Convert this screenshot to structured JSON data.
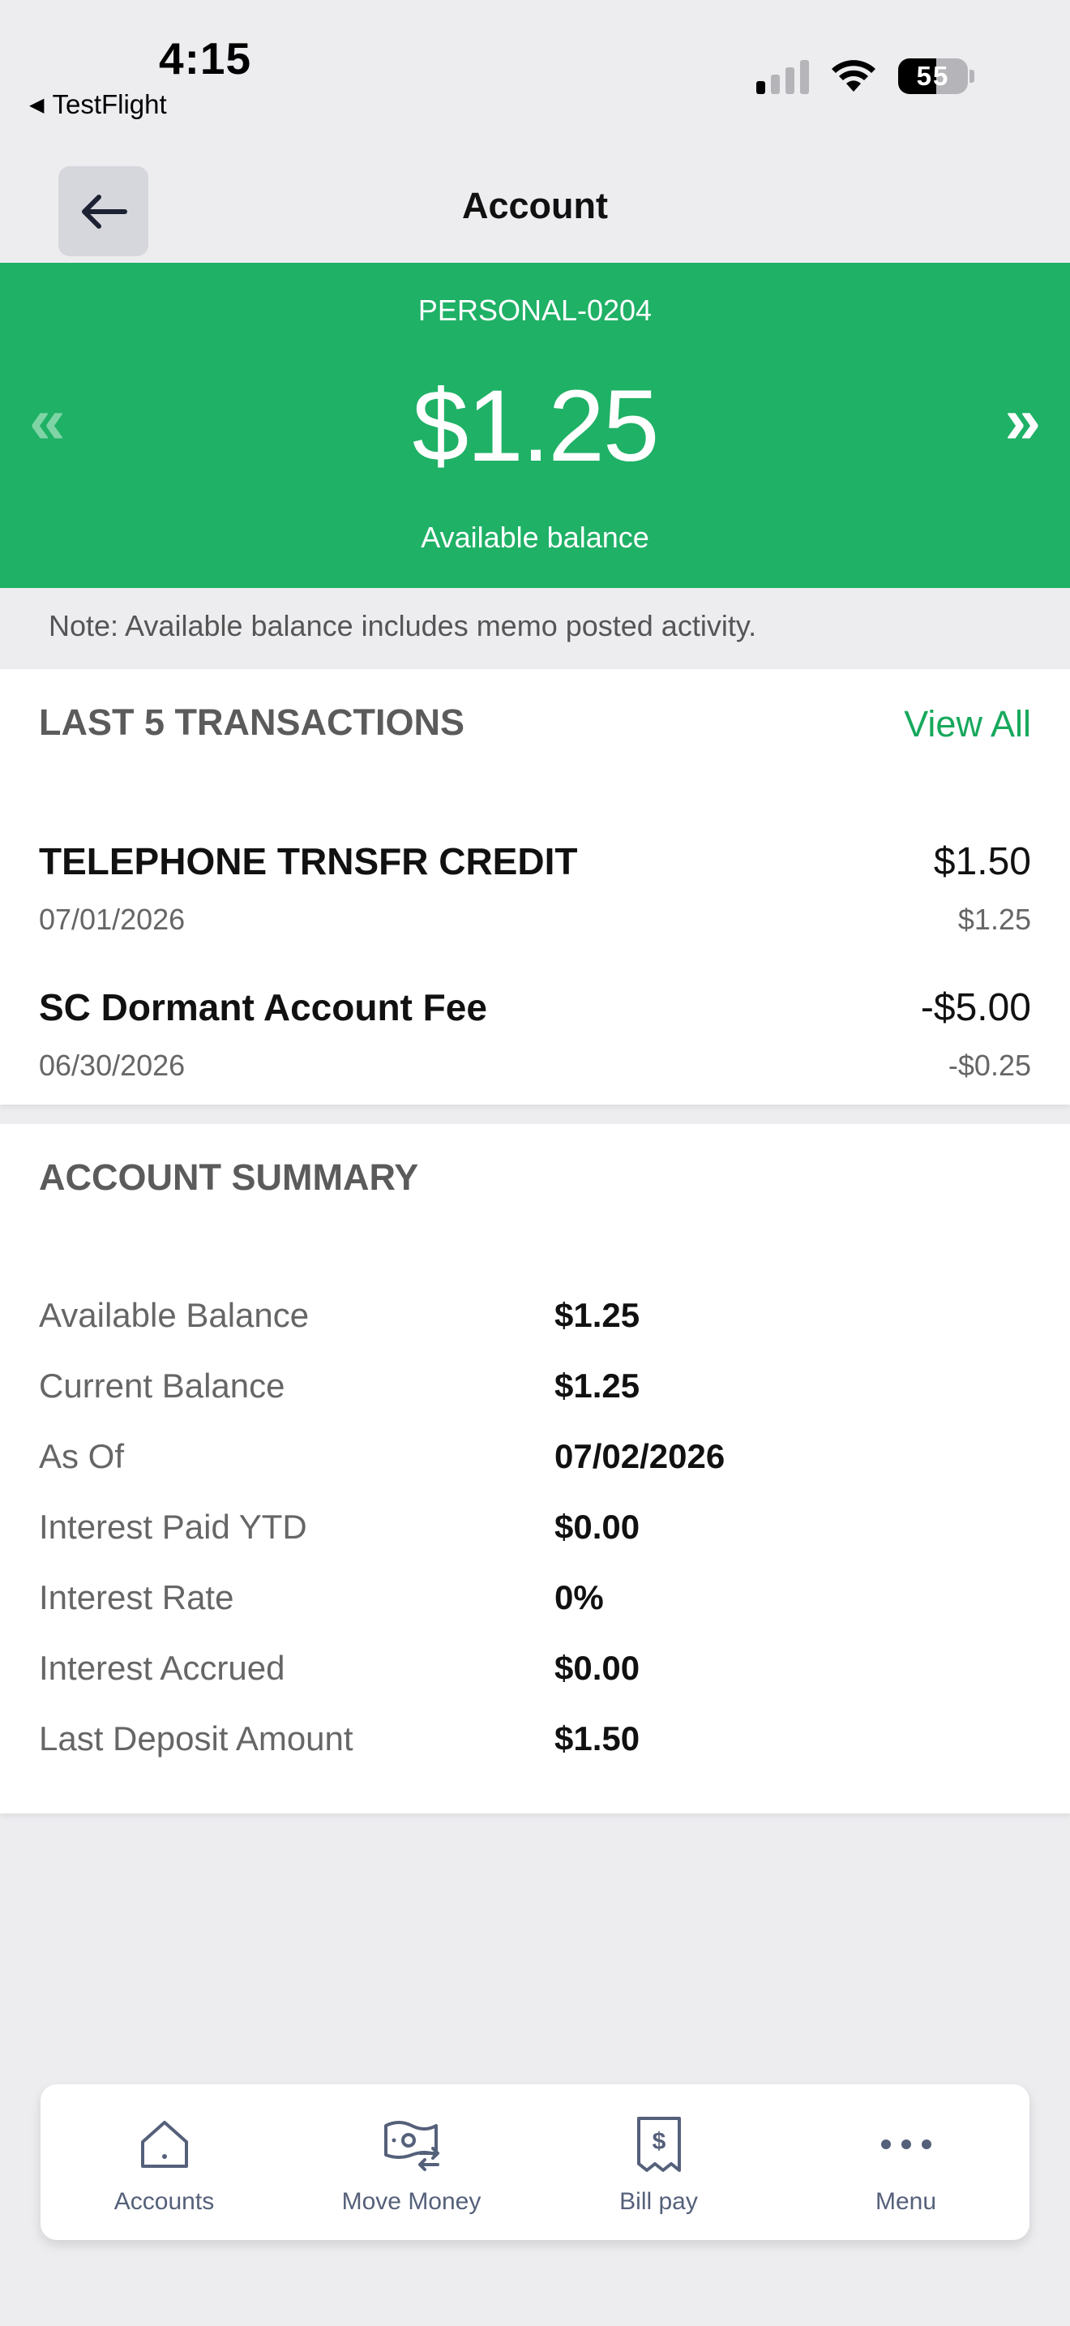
{
  "status_bar": {
    "time": "4:15",
    "back_app": "TestFlight",
    "battery": "55"
  },
  "header": {
    "title": "Account",
    "back_icon": "arrow-left-icon"
  },
  "balance_banner": {
    "account_name": "PERSONAL-0204",
    "amount": "$1.25",
    "label": "Available balance",
    "prev_arrow": "«",
    "next_arrow": "»",
    "color": "#1fb166"
  },
  "note": "Note: Available balance includes memo posted activity.",
  "transactions": {
    "heading": "LAST 5 TRANSACTIONS",
    "view_all": "View All",
    "items": [
      {
        "description": "TELEPHONE TRNSFR CREDIT",
        "date": "07/01/2026",
        "amount": "$1.50",
        "balance": "$1.25"
      },
      {
        "description": "SC Dormant Account Fee",
        "date": "06/30/2026",
        "amount": "-$5.00",
        "balance": "-$0.25"
      }
    ]
  },
  "summary": {
    "heading": "ACCOUNT SUMMARY",
    "rows": [
      {
        "label": "Available Balance",
        "value": "$1.25"
      },
      {
        "label": "Current Balance",
        "value": "$1.25"
      },
      {
        "label": "As Of",
        "value": "07/02/2026"
      },
      {
        "label": "Interest Paid YTD",
        "value": "$0.00"
      },
      {
        "label": "Interest Rate",
        "value": "0%"
      },
      {
        "label": "Interest Accrued",
        "value": "$0.00"
      },
      {
        "label": "Last Deposit Amount",
        "value": "$1.50"
      }
    ]
  },
  "bottom_nav": {
    "items": [
      {
        "label": "Accounts",
        "icon": "home-icon"
      },
      {
        "label": "Move Money",
        "icon": "money-transfer-icon"
      },
      {
        "label": "Bill pay",
        "icon": "bill-icon"
      },
      {
        "label": "Menu",
        "icon": "more-icon"
      }
    ]
  }
}
